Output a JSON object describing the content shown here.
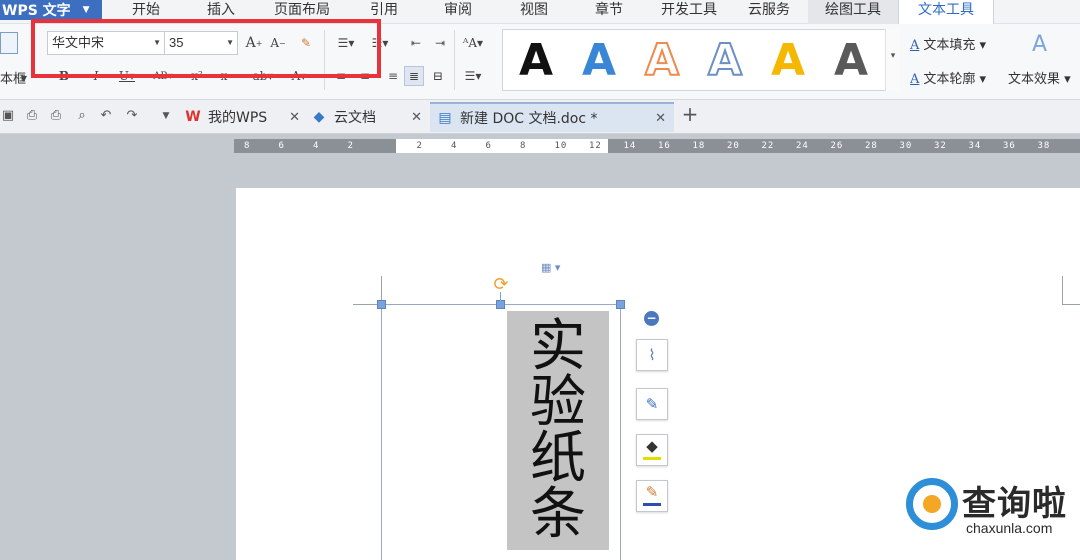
{
  "menubar": {
    "app_label": "WPS 文字",
    "items": [
      "开始",
      "插入",
      "页面布局",
      "引用",
      "审阅",
      "视图",
      "章节",
      "开发工具",
      "云服务",
      "绘图工具",
      "文本工具"
    ],
    "active": "文本工具"
  },
  "ribbon": {
    "left_cut_label": "本框",
    "font_name": "华文中宋",
    "font_size": "35",
    "text_fill_label": "文本填充",
    "text_outline_label": "文本轮廓",
    "text_effect_label": "文本效果",
    "art_styles": [
      {
        "name": "black",
        "color": "#111111"
      },
      {
        "name": "blue",
        "color": "#3a86d6"
      },
      {
        "name": "orange-outline",
        "color": "#f08a4b"
      },
      {
        "name": "blue-outline",
        "color": "#ffffff"
      },
      {
        "name": "yellow",
        "color": "#f5b800"
      },
      {
        "name": "gray-gradient",
        "color": "#4a4a4a"
      }
    ],
    "highlight_color": "#e8323c"
  },
  "tabs": [
    {
      "label": "我的WPS",
      "icon": "wps-icon",
      "active": false
    },
    {
      "label": "云文档",
      "icon": "cloud-doc-icon",
      "active": false
    },
    {
      "label": "新建 DOC 文档.doc *",
      "icon": "doc-icon",
      "active": true
    }
  ],
  "ruler": {
    "labels": [
      "8",
      "6",
      "4",
      "2",
      "",
      "2",
      "4",
      "6",
      "8",
      "10",
      "12",
      "14",
      "16",
      "18",
      "20",
      "22",
      "24",
      "26",
      "28",
      "30",
      "32",
      "34",
      "36",
      "38"
    ]
  },
  "document": {
    "vertical_text": [
      "实",
      "验",
      "纸",
      "条"
    ],
    "text_background": "#c4c4c4"
  },
  "watermark": {
    "title": "查询啦",
    "url": "chaxunla.com"
  }
}
